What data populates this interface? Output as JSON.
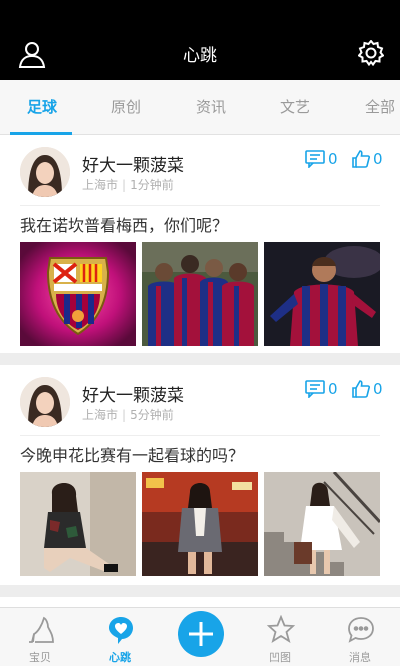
{
  "header": {
    "title": "心跳",
    "left_icon": "user-icon",
    "right_icon": "gear-icon"
  },
  "tabs": [
    {
      "label": "足球",
      "active": true
    },
    {
      "label": "原创",
      "active": false
    },
    {
      "label": "资讯",
      "active": false
    },
    {
      "label": "文艺",
      "active": false
    },
    {
      "label": "全部",
      "active": false
    }
  ],
  "posts": [
    {
      "author": "好大一颗菠菜",
      "location": "上海市",
      "time": "1分钟前",
      "comments": "0",
      "likes": "0",
      "text": "我在诺坎普看梅西，你们呢？",
      "images": [
        "fcb-crest-image",
        "team-celebration-image",
        "messi-image"
      ]
    },
    {
      "author": "好大一颗菠菜",
      "location": "上海市",
      "time": "5分钟前",
      "comments": "0",
      "likes": "0",
      "text": "今晚申花比赛有一起看球的吗？",
      "images": [
        "girl-sitting-image",
        "girl-street-image",
        "girl-stairs-image"
      ]
    }
  ],
  "bottom_nav": [
    {
      "label": "宝贝",
      "icon": "high-heel-icon",
      "active": false
    },
    {
      "label": "心跳",
      "icon": "heart-bubble-icon",
      "active": true
    },
    {
      "label": "",
      "icon": "plus-icon",
      "active": false
    },
    {
      "label": "凹图",
      "icon": "star-icon",
      "active": false
    },
    {
      "label": "消息",
      "icon": "chat-bubble-icon",
      "active": false
    }
  ],
  "colors": {
    "accent": "#18a4e8",
    "header_bg": "#000000",
    "muted": "#9a9a9a"
  }
}
